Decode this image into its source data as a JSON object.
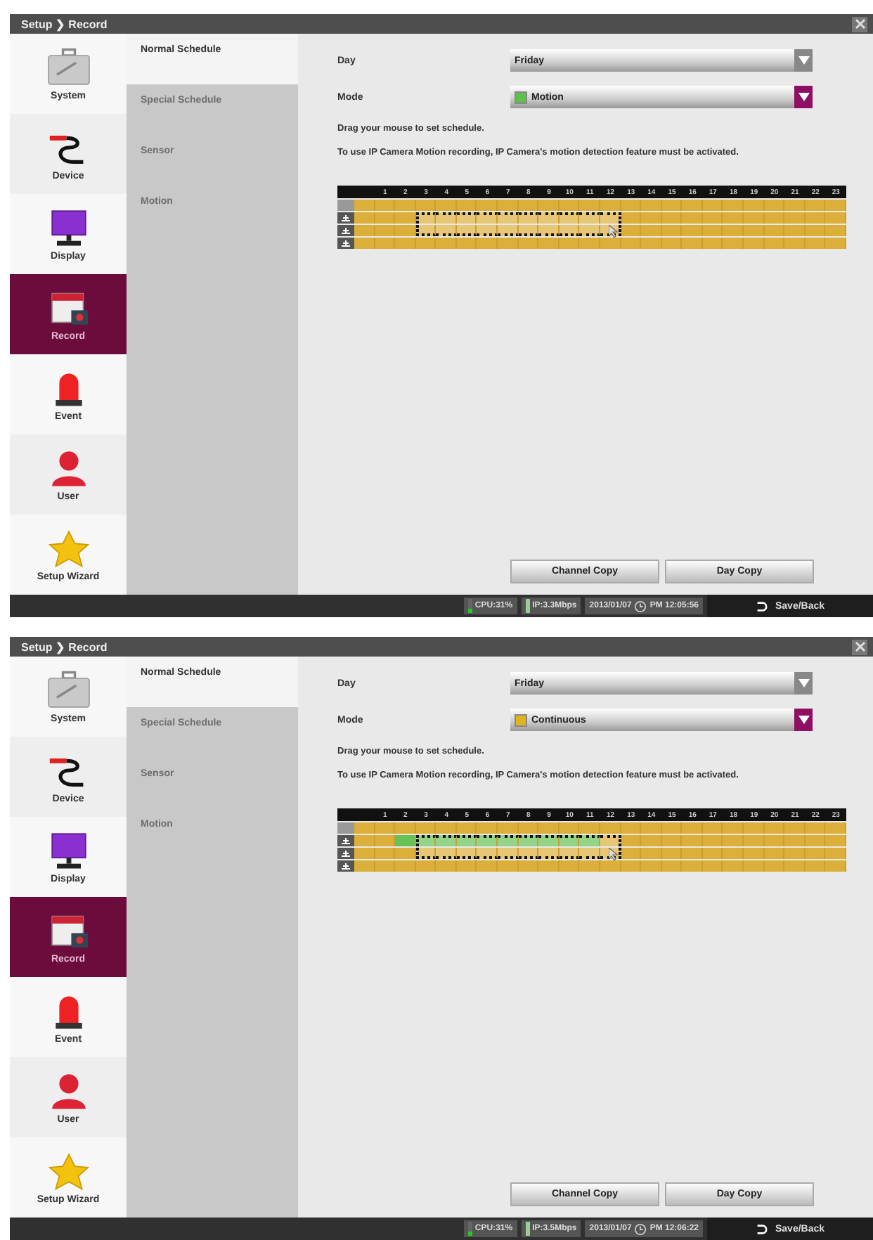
{
  "screens": [
    {
      "title": "Setup ❯ Record",
      "sidebar": [
        {
          "label": "System",
          "selected": false
        },
        {
          "label": "Device",
          "selected": false
        },
        {
          "label": "Display",
          "selected": false
        },
        {
          "label": "Record",
          "selected": true
        },
        {
          "label": "Event",
          "selected": false
        },
        {
          "label": "User",
          "selected": false
        },
        {
          "label": "Setup Wizard",
          "selected": false
        }
      ],
      "submenu": [
        {
          "label": "Normal Schedule",
          "selected": true
        },
        {
          "label": "Special Schedule",
          "selected": false
        },
        {
          "label": "Sensor",
          "selected": false
        },
        {
          "label": "Motion",
          "selected": false
        }
      ],
      "day": {
        "label": "Day",
        "value": "Friday",
        "focused": false
      },
      "mode": {
        "label": "Mode",
        "value": "Motion",
        "color": "#5cc04a",
        "focused": true
      },
      "hint": "Drag your mouse to set schedule.",
      "note": "To use IP Camera Motion recording, IP Camera's motion detection feature must be activated.",
      "hours": [
        "1",
        "2",
        "3",
        "4",
        "5",
        "6",
        "7",
        "8",
        "9",
        "10",
        "11",
        "12",
        "13",
        "14",
        "15",
        "16",
        "17",
        "18",
        "19",
        "20",
        "21",
        "22",
        "23"
      ],
      "rows": [
        {
          "kind": "all",
          "cells": [
            {
              "kind": "continuous",
              "selected": false
            },
            {
              "kind": "continuous",
              "selected": false
            },
            {
              "kind": "continuous",
              "selected": false
            },
            {
              "kind": "continuous",
              "selected": false
            },
            {
              "kind": "continuous",
              "selected": false
            },
            {
              "kind": "continuous",
              "selected": false
            },
            {
              "kind": "continuous",
              "selected": false
            },
            {
              "kind": "continuous",
              "selected": false
            },
            {
              "kind": "continuous",
              "selected": false
            },
            {
              "kind": "continuous",
              "selected": false
            },
            {
              "kind": "continuous",
              "selected": false
            },
            {
              "kind": "continuous",
              "selected": false
            },
            {
              "kind": "continuous",
              "selected": false
            },
            {
              "kind": "continuous",
              "selected": false
            },
            {
              "kind": "continuous",
              "selected": false
            },
            {
              "kind": "continuous",
              "selected": false
            },
            {
              "kind": "continuous",
              "selected": false
            },
            {
              "kind": "continuous",
              "selected": false
            },
            {
              "kind": "continuous",
              "selected": false
            },
            {
              "kind": "continuous",
              "selected": false
            },
            {
              "kind": "continuous",
              "selected": false
            },
            {
              "kind": "continuous",
              "selected": false
            },
            {
              "kind": "continuous",
              "selected": false
            },
            {
              "kind": "continuous",
              "selected": false
            }
          ]
        },
        {
          "kind": "channel",
          "cells": [
            {
              "kind": "continuous",
              "selected": false
            },
            {
              "kind": "continuous",
              "selected": false
            },
            {
              "kind": "continuous",
              "selected": false
            },
            {
              "kind": "continuous",
              "selected": true
            },
            {
              "kind": "continuous",
              "selected": true
            },
            {
              "kind": "continuous",
              "selected": true
            },
            {
              "kind": "continuous",
              "selected": true
            },
            {
              "kind": "continuous",
              "selected": true
            },
            {
              "kind": "continuous",
              "selected": true
            },
            {
              "kind": "continuous",
              "selected": true
            },
            {
              "kind": "continuous",
              "selected": true
            },
            {
              "kind": "continuous",
              "selected": true
            },
            {
              "kind": "continuous",
              "selected": true
            },
            {
              "kind": "continuous",
              "selected": false
            },
            {
              "kind": "continuous",
              "selected": false
            },
            {
              "kind": "continuous",
              "selected": false
            },
            {
              "kind": "continuous",
              "selected": false
            },
            {
              "kind": "continuous",
              "selected": false
            },
            {
              "kind": "continuous",
              "selected": false
            },
            {
              "kind": "continuous",
              "selected": false
            },
            {
              "kind": "continuous",
              "selected": false
            },
            {
              "kind": "continuous",
              "selected": false
            },
            {
              "kind": "continuous",
              "selected": false
            },
            {
              "kind": "continuous",
              "selected": false
            }
          ]
        },
        {
          "kind": "channel",
          "cells": [
            {
              "kind": "continuous",
              "selected": false
            },
            {
              "kind": "continuous",
              "selected": false
            },
            {
              "kind": "continuous",
              "selected": false
            },
            {
              "kind": "continuous",
              "selected": true
            },
            {
              "kind": "continuous",
              "selected": true
            },
            {
              "kind": "continuous",
              "selected": true
            },
            {
              "kind": "continuous",
              "selected": true
            },
            {
              "kind": "continuous",
              "selected": true
            },
            {
              "kind": "continuous",
              "selected": true
            },
            {
              "kind": "continuous",
              "selected": true
            },
            {
              "kind": "continuous",
              "selected": true
            },
            {
              "kind": "continuous",
              "selected": true
            },
            {
              "kind": "continuous",
              "selected": true
            },
            {
              "kind": "continuous",
              "selected": false
            },
            {
              "kind": "continuous",
              "selected": false
            },
            {
              "kind": "continuous",
              "selected": false
            },
            {
              "kind": "continuous",
              "selected": false
            },
            {
              "kind": "continuous",
              "selected": false
            },
            {
              "kind": "continuous",
              "selected": false
            },
            {
              "kind": "continuous",
              "selected": false
            },
            {
              "kind": "continuous",
              "selected": false
            },
            {
              "kind": "continuous",
              "selected": false
            },
            {
              "kind": "continuous",
              "selected": false
            },
            {
              "kind": "continuous",
              "selected": false
            }
          ]
        },
        {
          "kind": "channel",
          "cells": [
            {
              "kind": "continuous",
              "selected": false
            },
            {
              "kind": "continuous",
              "selected": false
            },
            {
              "kind": "continuous",
              "selected": false
            },
            {
              "kind": "continuous",
              "selected": false
            },
            {
              "kind": "continuous",
              "selected": false
            },
            {
              "kind": "continuous",
              "selected": false
            },
            {
              "kind": "continuous",
              "selected": false
            },
            {
              "kind": "continuous",
              "selected": false
            },
            {
              "kind": "continuous",
              "selected": false
            },
            {
              "kind": "continuous",
              "selected": false
            },
            {
              "kind": "continuous",
              "selected": false
            },
            {
              "kind": "continuous",
              "selected": false
            },
            {
              "kind": "continuous",
              "selected": false
            },
            {
              "kind": "continuous",
              "selected": false
            },
            {
              "kind": "continuous",
              "selected": false
            },
            {
              "kind": "continuous",
              "selected": false
            },
            {
              "kind": "continuous",
              "selected": false
            },
            {
              "kind": "continuous",
              "selected": false
            },
            {
              "kind": "continuous",
              "selected": false
            },
            {
              "kind": "continuous",
              "selected": false
            },
            {
              "kind": "continuous",
              "selected": false
            },
            {
              "kind": "continuous",
              "selected": false
            },
            {
              "kind": "continuous",
              "selected": false
            },
            {
              "kind": "continuous",
              "selected": false
            }
          ]
        }
      ],
      "buttons": [
        "Channel Copy",
        "Day Copy"
      ],
      "status": {
        "cpu": {
          "text": "CPU:31%",
          "level": 0.31
        },
        "ip": "IP:3.3Mbps",
        "date": "2013/01/07",
        "time": "PM 12:05:56",
        "back": "Save/Back"
      }
    },
    {
      "title": "Setup ❯ Record",
      "sidebar": [
        {
          "label": "System",
          "selected": false
        },
        {
          "label": "Device",
          "selected": false
        },
        {
          "label": "Display",
          "selected": false
        },
        {
          "label": "Record",
          "selected": true
        },
        {
          "label": "Event",
          "selected": false
        },
        {
          "label": "User",
          "selected": false
        },
        {
          "label": "Setup Wizard",
          "selected": false
        }
      ],
      "submenu": [
        {
          "label": "Normal Schedule",
          "selected": true
        },
        {
          "label": "Special Schedule",
          "selected": false
        },
        {
          "label": "Sensor",
          "selected": false
        },
        {
          "label": "Motion",
          "selected": false
        }
      ],
      "day": {
        "label": "Day",
        "value": "Friday",
        "focused": false
      },
      "mode": {
        "label": "Mode",
        "value": "Continuous",
        "color": "#e0b21e",
        "focused": true
      },
      "hint": "Drag your mouse to set schedule.",
      "note": "To use IP Camera Motion recording, IP Camera's motion detection feature must be activated.",
      "hours": [
        "1",
        "2",
        "3",
        "4",
        "5",
        "6",
        "7",
        "8",
        "9",
        "10",
        "11",
        "12",
        "13",
        "14",
        "15",
        "16",
        "17",
        "18",
        "19",
        "20",
        "21",
        "22",
        "23"
      ],
      "rows": [
        {
          "kind": "all",
          "cells": [
            {
              "kind": "continuous",
              "selected": false
            },
            {
              "kind": "continuous",
              "selected": false
            },
            {
              "kind": "continuous",
              "selected": false
            },
            {
              "kind": "continuous",
              "selected": false
            },
            {
              "kind": "continuous",
              "selected": false
            },
            {
              "kind": "continuous",
              "selected": false
            },
            {
              "kind": "continuous",
              "selected": false
            },
            {
              "kind": "continuous",
              "selected": false
            },
            {
              "kind": "continuous",
              "selected": false
            },
            {
              "kind": "continuous",
              "selected": false
            },
            {
              "kind": "continuous",
              "selected": false
            },
            {
              "kind": "continuous",
              "selected": false
            },
            {
              "kind": "continuous",
              "selected": false
            },
            {
              "kind": "continuous",
              "selected": false
            },
            {
              "kind": "continuous",
              "selected": false
            },
            {
              "kind": "continuous",
              "selected": false
            },
            {
              "kind": "continuous",
              "selected": false
            },
            {
              "kind": "continuous",
              "selected": false
            },
            {
              "kind": "continuous",
              "selected": false
            },
            {
              "kind": "continuous",
              "selected": false
            },
            {
              "kind": "continuous",
              "selected": false
            },
            {
              "kind": "continuous",
              "selected": false
            },
            {
              "kind": "continuous",
              "selected": false
            },
            {
              "kind": "continuous",
              "selected": false
            }
          ]
        },
        {
          "kind": "channel",
          "cells": [
            {
              "kind": "continuous",
              "selected": false
            },
            {
              "kind": "continuous",
              "selected": false
            },
            {
              "kind": "motion",
              "selected": false
            },
            {
              "kind": "motion",
              "selected": true
            },
            {
              "kind": "motion",
              "selected": true
            },
            {
              "kind": "motion",
              "selected": true
            },
            {
              "kind": "motion",
              "selected": true
            },
            {
              "kind": "motion",
              "selected": true
            },
            {
              "kind": "motion",
              "selected": true
            },
            {
              "kind": "motion",
              "selected": true
            },
            {
              "kind": "motion",
              "selected": true
            },
            {
              "kind": "motion",
              "selected": true
            },
            {
              "kind": "continuous",
              "selected": true
            },
            {
              "kind": "continuous",
              "selected": false
            },
            {
              "kind": "continuous",
              "selected": false
            },
            {
              "kind": "continuous",
              "selected": false
            },
            {
              "kind": "continuous",
              "selected": false
            },
            {
              "kind": "continuous",
              "selected": false
            },
            {
              "kind": "continuous",
              "selected": false
            },
            {
              "kind": "continuous",
              "selected": false
            },
            {
              "kind": "continuous",
              "selected": false
            },
            {
              "kind": "continuous",
              "selected": false
            },
            {
              "kind": "continuous",
              "selected": false
            },
            {
              "kind": "continuous",
              "selected": false
            }
          ]
        },
        {
          "kind": "channel",
          "cells": [
            {
              "kind": "continuous",
              "selected": false
            },
            {
              "kind": "continuous",
              "selected": false
            },
            {
              "kind": "continuous",
              "selected": false
            },
            {
              "kind": "continuous",
              "selected": true
            },
            {
              "kind": "continuous",
              "selected": true
            },
            {
              "kind": "continuous",
              "selected": true
            },
            {
              "kind": "continuous",
              "selected": true
            },
            {
              "kind": "continuous",
              "selected": true
            },
            {
              "kind": "continuous",
              "selected": true
            },
            {
              "kind": "continuous",
              "selected": true
            },
            {
              "kind": "continuous",
              "selected": true
            },
            {
              "kind": "continuous",
              "selected": true
            },
            {
              "kind": "continuous",
              "selected": true
            },
            {
              "kind": "continuous",
              "selected": false
            },
            {
              "kind": "continuous",
              "selected": false
            },
            {
              "kind": "continuous",
              "selected": false
            },
            {
              "kind": "continuous",
              "selected": false
            },
            {
              "kind": "continuous",
              "selected": false
            },
            {
              "kind": "continuous",
              "selected": false
            },
            {
              "kind": "continuous",
              "selected": false
            },
            {
              "kind": "continuous",
              "selected": false
            },
            {
              "kind": "continuous",
              "selected": false
            },
            {
              "kind": "continuous",
              "selected": false
            },
            {
              "kind": "continuous",
              "selected": false
            }
          ]
        },
        {
          "kind": "channel",
          "cells": [
            {
              "kind": "continuous",
              "selected": false
            },
            {
              "kind": "continuous",
              "selected": false
            },
            {
              "kind": "continuous",
              "selected": false
            },
            {
              "kind": "continuous",
              "selected": false
            },
            {
              "kind": "continuous",
              "selected": false
            },
            {
              "kind": "continuous",
              "selected": false
            },
            {
              "kind": "continuous",
              "selected": false
            },
            {
              "kind": "continuous",
              "selected": false
            },
            {
              "kind": "continuous",
              "selected": false
            },
            {
              "kind": "continuous",
              "selected": false
            },
            {
              "kind": "continuous",
              "selected": false
            },
            {
              "kind": "continuous",
              "selected": false
            },
            {
              "kind": "continuous",
              "selected": false
            },
            {
              "kind": "continuous",
              "selected": false
            },
            {
              "kind": "continuous",
              "selected": false
            },
            {
              "kind": "continuous",
              "selected": false
            },
            {
              "kind": "continuous",
              "selected": false
            },
            {
              "kind": "continuous",
              "selected": false
            },
            {
              "kind": "continuous",
              "selected": false
            },
            {
              "kind": "continuous",
              "selected": false
            },
            {
              "kind": "continuous",
              "selected": false
            },
            {
              "kind": "continuous",
              "selected": false
            },
            {
              "kind": "continuous",
              "selected": false
            },
            {
              "kind": "continuous",
              "selected": false
            }
          ]
        }
      ],
      "buttons": [
        "Channel Copy",
        "Day Copy"
      ],
      "status": {
        "cpu": {
          "text": "CPU:31%",
          "level": 0.31
        },
        "ip": "IP:3.5Mbps",
        "date": "2013/01/07",
        "time": "PM 12:06:22",
        "back": "Save/Back"
      }
    }
  ]
}
